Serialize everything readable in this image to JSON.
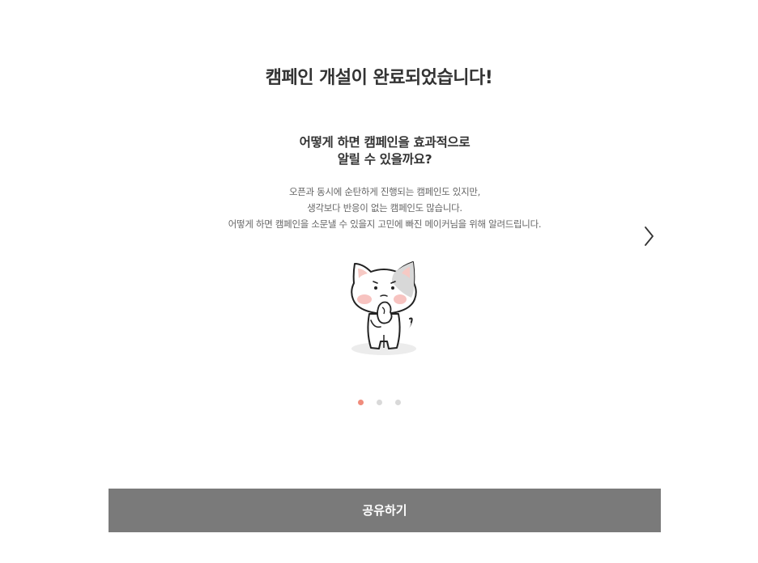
{
  "page": {
    "title": "캠페인 개설이 완료되었습니다!"
  },
  "slide": {
    "heading_lines": [
      "어떻게 하면 캠페인을 효과적으로",
      "알릴 수 있을까요?"
    ],
    "body_lines": [
      "오픈과 동시에 순탄하게 진행되는 캠페인도 있지만,",
      "생각보다 반응이 없는 캠페인도 많습니다.",
      "어떻게 하면 캠페인을 소문낼 수 있을지 고민에 빠진 메이커님을 위해 알려드립니다."
    ],
    "illustration": "thinking-cat-illustration",
    "next_icon": "chevron-right-icon"
  },
  "pagination": {
    "count": 3,
    "active_index": 0,
    "active_color": "#f08c7c",
    "inactive_color": "#d9d9d9"
  },
  "share_button": {
    "label": "공유하기",
    "background": "#7a7a7a"
  }
}
